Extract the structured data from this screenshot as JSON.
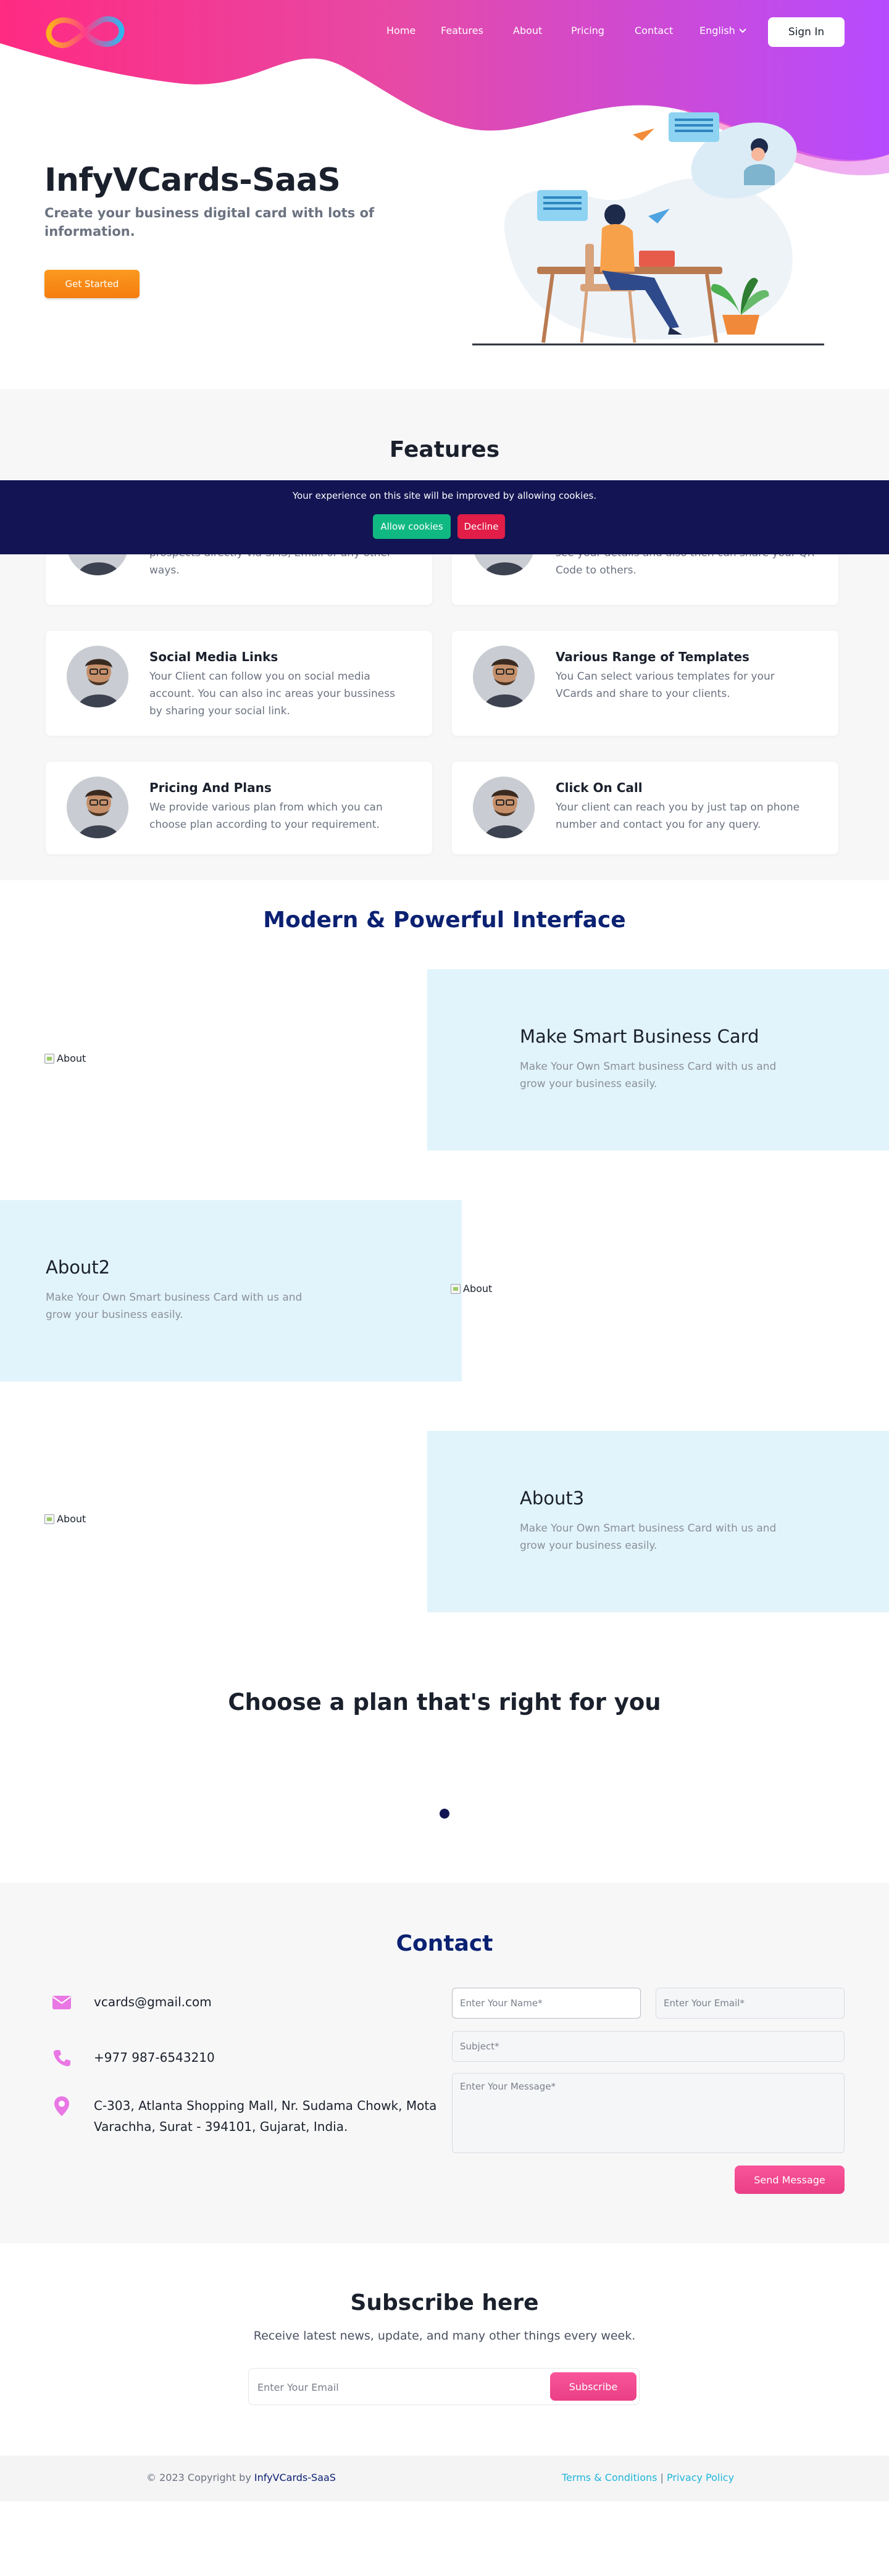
{
  "header": {
    "nav": [
      "Home",
      "Features",
      "About",
      "Pricing",
      "Contact"
    ],
    "language": "English",
    "sign_in": "Sign In"
  },
  "hero": {
    "title": "InfyVCards-SaaS",
    "subtitle": "Create your business digital card with lots of information.",
    "cta": "Get Started"
  },
  "features": {
    "title": "Features",
    "cards": [
      {
        "title": "",
        "text": "prospects directly via SMS, Email or any other ways."
      },
      {
        "title": "",
        "text": "see your details and also then can share your QR Code to others."
      },
      {
        "title": "Social Media Links",
        "text": "Your Client can follow you on social media account. You can also inc areas your bussiness by sharing your social link."
      },
      {
        "title": "Various Range of Templates",
        "text": "You Can select various templates for your VCards and share to your clients."
      },
      {
        "title": "Pricing And Plans",
        "text": "We provide various plan from which you can choose plan according to your requirement."
      },
      {
        "title": "Click On Call",
        "text": "Your client can reach you by just tap on phone number and contact you for any query."
      }
    ]
  },
  "cookie": {
    "message": "Your experience on this site will be improved by allowing cookies.",
    "allow": "Allow cookies",
    "decline": "Decline"
  },
  "interface": {
    "title": "Modern & Powerful Interface",
    "blocks": [
      {
        "title": "Make Smart Business Card",
        "text": "Make Your Own Smart business Card with us and grow your business easily.",
        "img_alt": "About"
      },
      {
        "title": "About2",
        "text": "Make Your Own Smart business Card with us and grow your business easily.",
        "img_alt": "About"
      },
      {
        "title": "About3",
        "text": "Make Your Own Smart business Card with us and grow your business easily.",
        "img_alt": "About"
      }
    ]
  },
  "plans": {
    "title": "Choose a plan that's right for you"
  },
  "contact": {
    "title": "Contact",
    "email": "vcards@gmail.com",
    "phone": "+977 987-6543210",
    "address": "C-303, Atlanta Shopping Mall, Nr. Sudama Chowk, Mota Varachha, Surat - 394101, Gujarat, India.",
    "form": {
      "name_placeholder": "Enter Your Name*",
      "email_placeholder": "Enter Your Email*",
      "subject_placeholder": "Subject*",
      "message_placeholder": "Enter Your Message*",
      "send": "Send Message"
    }
  },
  "subscribe": {
    "title": "Subscribe here",
    "text": "Receive latest news, update, and many other things every week.",
    "placeholder": "Enter Your Email",
    "button": "Subscribe"
  },
  "footer": {
    "copyright": "© 2023 Copyright by",
    "brand": "InfyVCards-SaaS",
    "terms": "Terms & Conditions",
    "separator": "|",
    "privacy": "Privacy Policy"
  },
  "colors": {
    "accent_pink": "#f9559a",
    "brand_navy": "#0b2172",
    "cookie_bg": "#121453",
    "allow_green": "#10b981",
    "decline_red": "#e11d48",
    "cta_orange": "#f57c0f"
  }
}
